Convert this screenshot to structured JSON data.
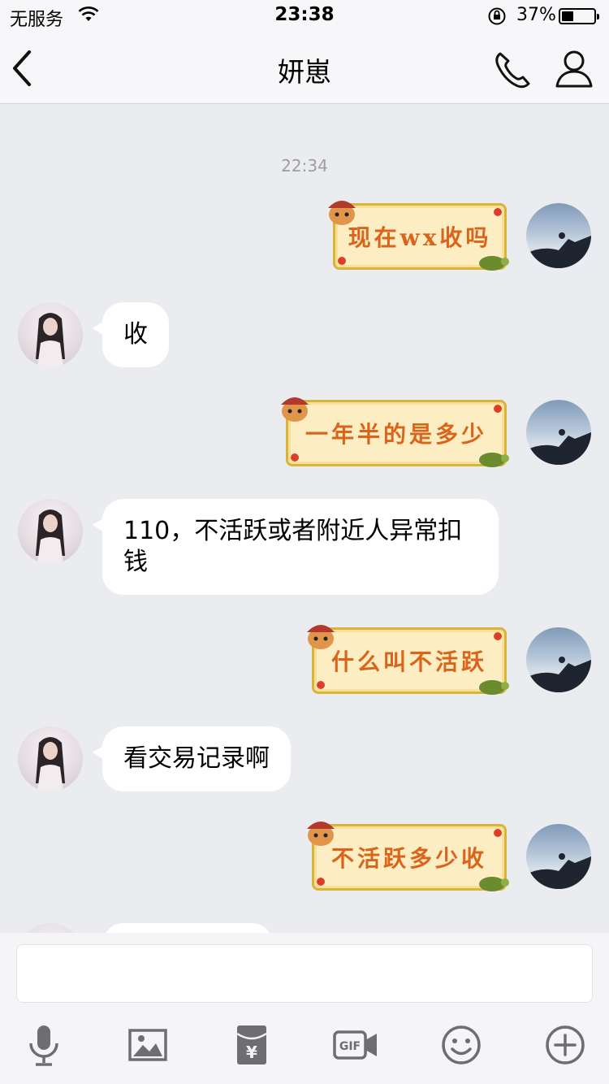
{
  "status_bar": {
    "carrier": "无服务",
    "time": "23:38",
    "battery_text": "37%",
    "battery_level": 0.37
  },
  "nav": {
    "title": "妍崽"
  },
  "chat": {
    "timestamp": "22:34",
    "messages": [
      {
        "from": "me",
        "type": "sticker",
        "text": "现在wx收吗"
      },
      {
        "from": "other",
        "type": "text",
        "text": "收"
      },
      {
        "from": "me",
        "type": "sticker",
        "text": "一年半的是多少"
      },
      {
        "from": "other",
        "type": "text",
        "line1": "110，不活跃或者附近人异常扣",
        "line2": "钱"
      },
      {
        "from": "me",
        "type": "sticker",
        "text": "什么叫不活跃"
      },
      {
        "from": "other",
        "type": "text",
        "text": "看交易记录啊"
      },
      {
        "from": "me",
        "type": "sticker",
        "text": "不活跃多少收"
      }
    ]
  },
  "input": {
    "value": "",
    "placeholder": ""
  },
  "icons": {
    "back": "chevron-left-icon",
    "call": "phone-icon",
    "profile": "person-icon",
    "voice": "microphone-icon",
    "image": "image-icon",
    "redpacket": "red-packet-icon",
    "gif": "gif-icon",
    "emoji": "emoji-icon",
    "more": "plus-circle-icon"
  },
  "colors": {
    "background": "#EBECF0",
    "sticker_text": "#D9651C",
    "sticker_fill": "#FCEEC2",
    "icon_gray": "#6E6E72"
  }
}
